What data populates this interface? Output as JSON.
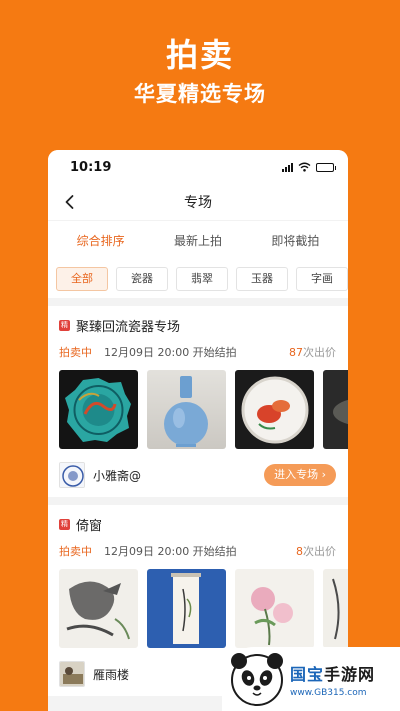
{
  "promo": {
    "title": "拍卖",
    "subtitle": "华夏精选专场"
  },
  "status_bar": {
    "time": "10:19"
  },
  "nav": {
    "title": "专场"
  },
  "sort_tabs": [
    "综合排序",
    "最新上拍",
    "即将截拍"
  ],
  "categories": [
    "全部",
    "瓷器",
    "翡翠",
    "玉器",
    "字画"
  ],
  "cards": [
    {
      "badge": "精",
      "title": "聚臻回流瓷器专场",
      "status": "拍卖中",
      "time": "12月09日 20:00  开始结拍",
      "bid_count": "87",
      "bid_suffix": "次出价",
      "seller": "小雅斋@",
      "enter_label": "进入专场 ›"
    },
    {
      "badge": "精",
      "title": "倚窗",
      "status": "拍卖中",
      "time": "12月09日 20:00  开始结拍",
      "bid_count": "8",
      "bid_suffix": "次出价",
      "seller": "雁雨楼"
    }
  ],
  "watermark": {
    "name_a": "国宝",
    "name_b": "手游网",
    "url": "www.GB315.com"
  },
  "colors": {
    "brand_orange": "#f57a12",
    "accent": "#e8661e",
    "button": "#f59b57",
    "badge_red": "#e0413b"
  },
  "icons": [
    "signal-icon",
    "wifi-icon",
    "battery-icon",
    "back-arrow-icon",
    "chevron-right-icon",
    "panda-logo-icon"
  ]
}
